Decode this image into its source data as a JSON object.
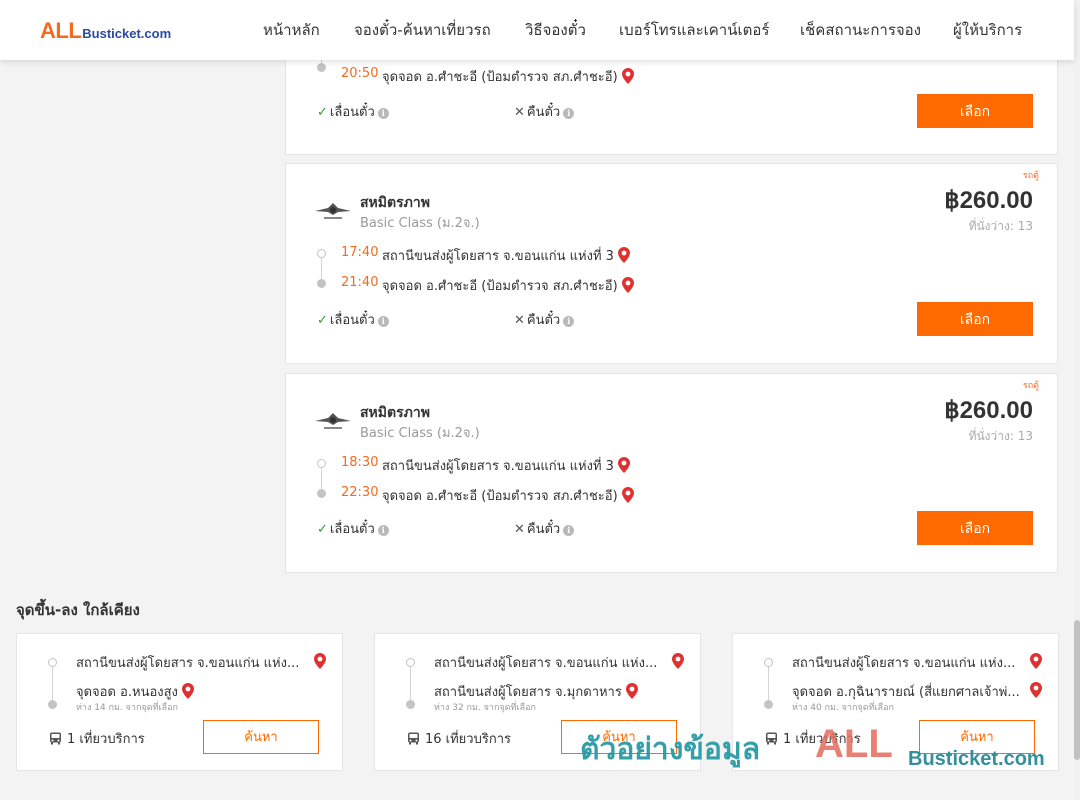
{
  "header": {
    "logo_all": "ALL",
    "logo_bus": "Busticket.com",
    "nav": [
      "หน้าหลัก",
      "จองตั๋ว-ค้นหาเที่ยวรถ",
      "วิธีจองตั๋ว",
      "เบอร์โทรและเคาน์เตอร์",
      "เช็คสถานะการจอง",
      "ผู้ให้บริการ"
    ]
  },
  "trips": [
    {
      "arrive_time": "20:50",
      "arrive_place": "จุดจอด อ.ศำชะอี (ป้อมตำรวจ สภ.ศำชะอี)",
      "reschedule": "เลื่อนตั๋ว",
      "refund": "คืนตั๋ว",
      "button": "เลือก"
    },
    {
      "badge": "รถดู้",
      "operator": "สหมิตรภาพ",
      "class": "Basic Class (ม.2จ.)",
      "price": "฿260.00",
      "seats": "ที่นั่งว่าง: 13",
      "depart_time": "17:40",
      "depart_place": "สถานีขนส่งผู้โดยสาร จ.ขอนแก่น แห่งที่ 3",
      "arrive_time": "21:40",
      "arrive_place": "จุดจอด อ.ศำชะอี (ป้อมตำรวจ สภ.ศำชะอี)",
      "reschedule": "เลื่อนตั๋ว",
      "refund": "คืนตั๋ว",
      "button": "เลือก"
    },
    {
      "badge": "รถดู้",
      "operator": "สหมิตรภาพ",
      "class": "Basic Class (ม.2จ.)",
      "price": "฿260.00",
      "seats": "ที่นั่งว่าง: 13",
      "depart_time": "18:30",
      "depart_place": "สถานีขนส่งผู้โดยสาร จ.ขอนแก่น แห่งที่ 3",
      "arrive_time": "22:30",
      "arrive_place": "จุดจอด อ.ศำชะอี (ป้อมตำรวจ สภ.ศำชะอี)",
      "reschedule": "เลื่อนตั๋ว",
      "refund": "คืนตั๋ว",
      "button": "เลือก"
    }
  ],
  "nearby": {
    "title": "จุดขึ้น-ลง ใกล้เคียง",
    "items": [
      {
        "from": "สถานีขนส่งผู้โดยสาร จ.ขอนแก่น แห่ง...",
        "to": "จุดจอด อ.หนองสูง",
        "distance": "ห่าง 14 กม. จากจุดที่เลือก",
        "trips": "1 เที่ยวบริการ",
        "button": "ค้นหา"
      },
      {
        "from": "สถานีขนส่งผู้โดยสาร จ.ขอนแก่น แห่ง...",
        "to": "สถานีขนส่งผู้โดยสาร จ.มุกดาหาร",
        "distance": "ห่าง 32 กม. จากจุดที่เลือก",
        "trips": "16 เที่ยวบริการ",
        "button": "ค้นหา"
      },
      {
        "from": "สถานีขนส่งผู้โดยสาร จ.ขอนแก่น แห่ง...",
        "to": "จุดจอด อ.กุฉินารายณ์ (สี่แยกศาลเจ้าพ่...",
        "distance": "ห่าง 40 กม. จากจุดที่เลือก",
        "trips": "1 เที่ยวบริการ",
        "button": "ค้นหา"
      }
    ]
  },
  "watermark": {
    "text": "ตัวอย่างข้อมูล",
    "all": "ALL",
    "bus": "Busticket.com"
  },
  "colors": {
    "accent": "#ff6a00",
    "time": "#f36b21",
    "pin": "#e03131",
    "check": "#2e9c3f"
  }
}
